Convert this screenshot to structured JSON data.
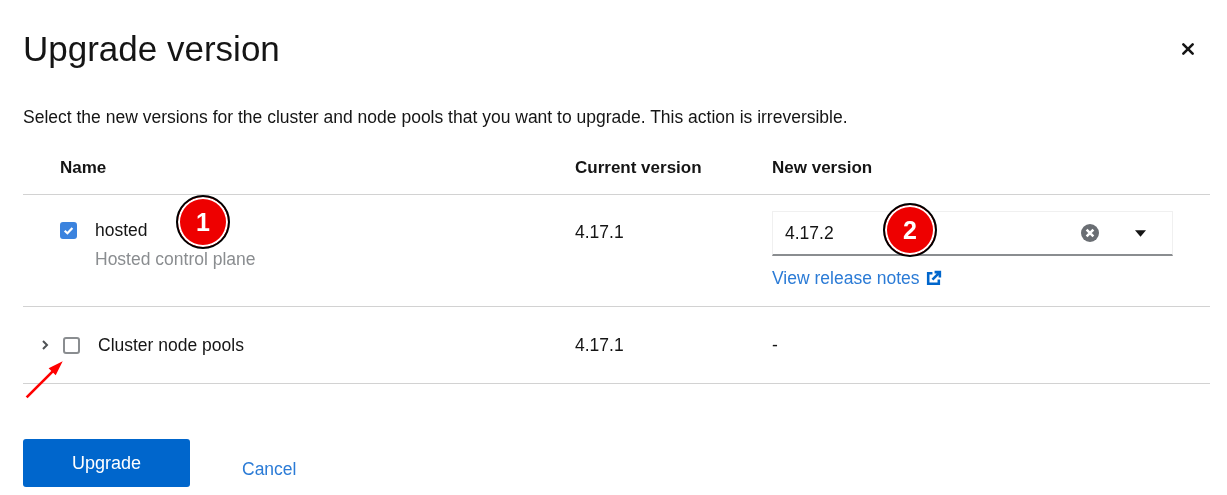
{
  "modal": {
    "title": "Upgrade version",
    "description": "Select the new versions for the cluster and node pools that you want to upgrade. This action is irreversible."
  },
  "table": {
    "columns": [
      "Name",
      "Current version",
      "New version"
    ],
    "rows": [
      {
        "kind": "item",
        "name": "hosted",
        "description": "Hosted control plane",
        "checked": true,
        "current_version": "4.17.1",
        "new_version": {
          "kind": "select",
          "value": "4.17.2",
          "link": "View release notes"
        }
      },
      {
        "kind": "group",
        "expanded": false,
        "name": "Cluster node pools",
        "checked": false,
        "current_version": "4.17.1",
        "new_version": {
          "kind": "text",
          "value": "-"
        }
      }
    ]
  },
  "buttons": [
    {
      "label": "Upgrade",
      "kind": "primary"
    },
    {
      "label": "Cancel",
      "kind": "link"
    }
  ],
  "annotations": [
    {
      "kind": "number",
      "text": "1"
    },
    {
      "kind": "number",
      "text": "2"
    },
    {
      "kind": "arrow"
    }
  ]
}
